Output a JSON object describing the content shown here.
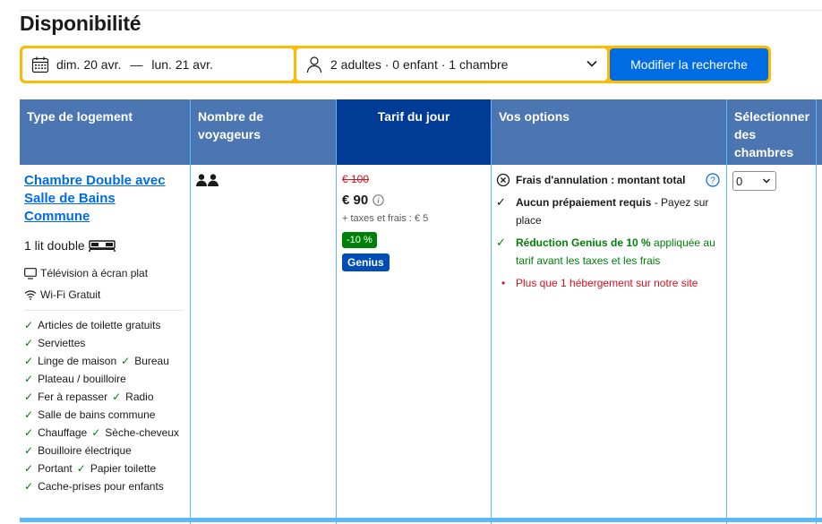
{
  "page": {
    "title": "Disponibilité"
  },
  "search": {
    "checkin": "dim. 20 avr.",
    "dash": "—",
    "checkout": "lun. 21 avr.",
    "guests": "2 adultes · 0 enfant · 1 chambre",
    "button": "Modifier la recherche"
  },
  "table": {
    "headers": {
      "type": "Type de logement",
      "guests": "Nombre de voyageurs",
      "rate": "Tarif du jour",
      "options": "Vos options",
      "select": "Sélectionner des chambres"
    }
  },
  "room": {
    "name": "Chambre Double avec Salle de Bains Commune",
    "bed": "1 lit double",
    "facilities": [
      "Télévision à écran plat",
      "Wi-Fi Gratuit"
    ],
    "amenities": [
      "Articles de toilette gratuits",
      "Serviettes",
      "Linge de maison",
      "Bureau",
      "Plateau / bouilloire",
      "Fer à repasser",
      "Radio",
      "Salle de bains commune",
      "Chauffage",
      "Sèche-cheveux",
      "Bouilloire électrique",
      "Portant",
      "Papier toilette",
      "Cache-prises pour enfants"
    ]
  },
  "rate": {
    "old_price": "€ 100",
    "price": "€ 90",
    "taxes": "+ taxes et frais : € 5",
    "discount": "-10 %",
    "genius": "Genius"
  },
  "options": {
    "cancel": "Frais d'annulation : montant total",
    "prepay_bold": "Aucun prépaiement requis",
    "prepay_rest": " - Payez sur place",
    "genius_bold": "Réduction Genius de 10 %",
    "genius_rest": " appliquée au tarif avant les taxes et les frais",
    "scarcity": "Plus que 1 hébergement sur notre site"
  },
  "select": {
    "value": "0"
  },
  "colors": {
    "brand_blue": "#006ce4",
    "header_blue": "#4c76b2",
    "rate_header": "#003b95",
    "yellow": "#febb02",
    "green": "#008009",
    "red": "#d4111e"
  }
}
